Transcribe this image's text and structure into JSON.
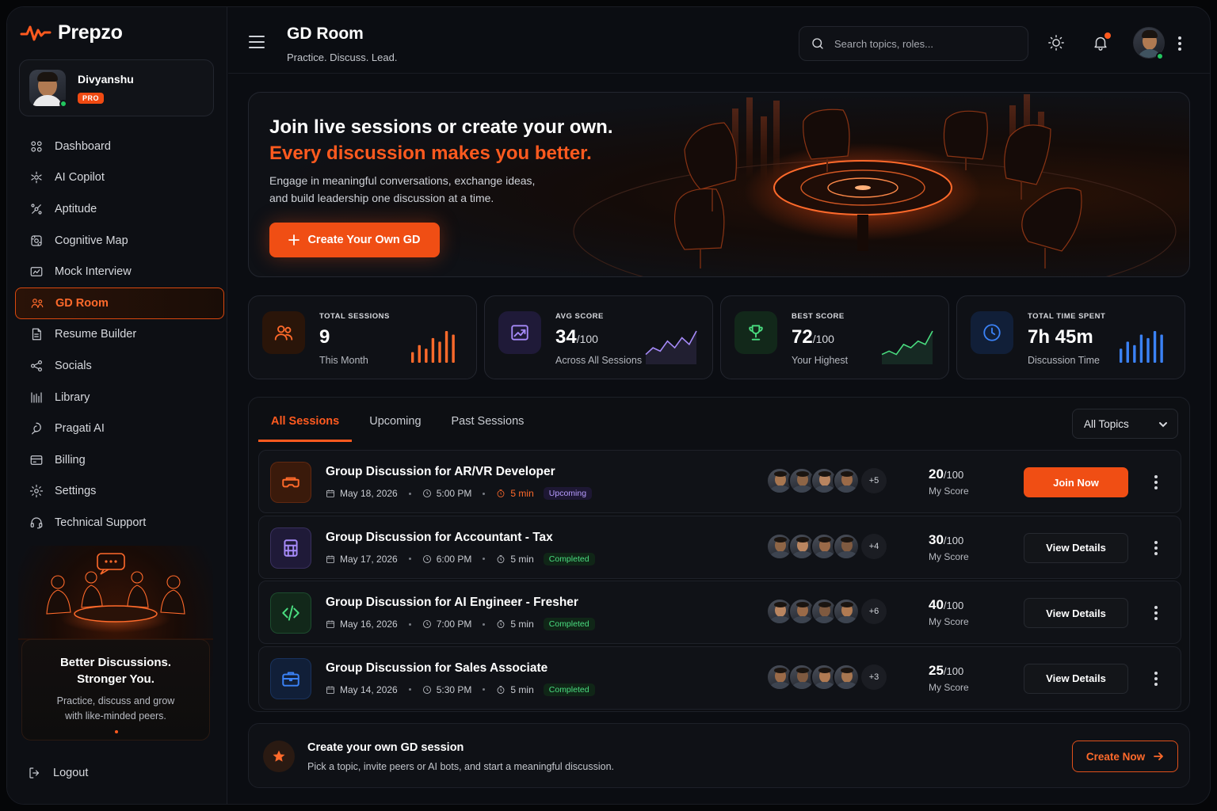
{
  "brand": {
    "name": "Prepzo",
    "accent": "#f04e14"
  },
  "user": {
    "name": "Divyanshu",
    "badge": "PRO"
  },
  "sidebar": {
    "items": [
      {
        "label": "Dashboard",
        "icon": "dashboard-icon"
      },
      {
        "label": "AI Copilot",
        "icon": "copilot-icon"
      },
      {
        "label": "Aptitude",
        "icon": "aptitude-icon"
      },
      {
        "label": "Cognitive Map",
        "icon": "cognitive-map-icon"
      },
      {
        "label": "Mock Interview",
        "icon": "mock-interview-icon"
      },
      {
        "label": "GD Room",
        "icon": "gd-room-icon",
        "active": true
      },
      {
        "label": "Resume Builder",
        "icon": "resume-icon"
      },
      {
        "label": "Socials",
        "icon": "share-icon"
      },
      {
        "label": "Library",
        "icon": "library-icon"
      },
      {
        "label": "Pragati AI",
        "icon": "pragati-icon"
      },
      {
        "label": "Billing",
        "icon": "billing-icon"
      },
      {
        "label": "Settings",
        "icon": "gear-icon"
      },
      {
        "label": "Technical Support",
        "icon": "headset-icon"
      }
    ],
    "promo": {
      "title_line1": "Better Discussions.",
      "title_line2": "Stronger You.",
      "sub_line1": "Practice, discuss and grow",
      "sub_line2": "with like-minded peers."
    },
    "logout": "Logout"
  },
  "header": {
    "title": "GD Room",
    "subtitle": "Practice. Discuss. Lead.",
    "search_placeholder": "Search topics, roles..."
  },
  "hero": {
    "line1": "Join live sessions or create your own.",
    "line2": "Every discussion makes you better.",
    "desc_line1": "Engage in meaningful conversations, exchange ideas,",
    "desc_line2": "and build leadership one discussion at a time.",
    "button": "Create Your Own GD"
  },
  "stats": [
    {
      "label": "TOTAL SESSIONS",
      "value": "9",
      "unit": "",
      "sub": "This Month",
      "color": "#ff6a2b",
      "bg": "#2a1509",
      "icon": "users-icon",
      "chart": "bars",
      "series": [
        3,
        5,
        4,
        7,
        6,
        9,
        8
      ]
    },
    {
      "label": "AVG SCORE",
      "value": "34",
      "unit": "/100",
      "sub": "Across All Sessions",
      "color": "#a78bfa",
      "bg": "#1f1a38",
      "icon": "trend-up-icon",
      "chart": "line",
      "series": [
        2,
        4,
        3,
        6,
        4,
        7,
        5,
        9
      ]
    },
    {
      "label": "BEST SCORE",
      "value": "72",
      "unit": "/100",
      "sub": "Your Highest",
      "color": "#4ade80",
      "bg": "#12281a",
      "icon": "trophy-icon",
      "chart": "line",
      "series": [
        2,
        3,
        2,
        5,
        4,
        6,
        5,
        9
      ]
    },
    {
      "label": "TOTAL TIME SPENT",
      "value": "7h 45m",
      "unit": "",
      "sub": "Discussion Time",
      "color": "#3b82f6",
      "bg": "#111f38",
      "icon": "clock-icon",
      "chart": "bars",
      "series": [
        4,
        6,
        5,
        8,
        7,
        9,
        8
      ]
    }
  ],
  "tabs": [
    "All Sessions",
    "Upcoming",
    "Past Sessions"
  ],
  "topic_filter": "All Topics",
  "sessions": [
    {
      "title": "Group Discussion for AR/VR Developer",
      "date": "May 18, 2026",
      "time": "5:00 PM",
      "duration": "5 min",
      "status": "Upcoming",
      "more": "+5",
      "score": "20",
      "score_unit": "/100",
      "score_label": "My Score",
      "action": "Join Now",
      "primary": true,
      "icon": "vr-headset-icon",
      "color": "#ff6a2b",
      "bg": "#3a1a0b"
    },
    {
      "title": "Group Discussion for Accountant - Tax",
      "date": "May 17, 2026",
      "time": "6:00 PM",
      "duration": "5 min",
      "status": "Completed",
      "more": "+4",
      "score": "30",
      "score_unit": "/100",
      "score_label": "My Score",
      "action": "View Details",
      "primary": false,
      "icon": "calculator-icon",
      "color": "#a78bfa",
      "bg": "#1f1a38"
    },
    {
      "title": "Group Discussion for AI Engineer - Fresher",
      "date": "May 16, 2026",
      "time": "7:00 PM",
      "duration": "5 min",
      "status": "Completed",
      "more": "+6",
      "score": "40",
      "score_unit": "/100",
      "score_label": "My Score",
      "action": "View Details",
      "primary": false,
      "icon": "code-icon",
      "color": "#4ade80",
      "bg": "#12281a"
    },
    {
      "title": "Group Discussion for Sales Associate",
      "date": "May 14, 2026",
      "time": "5:30 PM",
      "duration": "5 min",
      "status": "Completed",
      "more": "+3",
      "score": "25",
      "score_unit": "/100",
      "score_label": "My Score",
      "action": "View Details",
      "primary": false,
      "icon": "briefcase-icon",
      "color": "#3b82f6",
      "bg": "#111f38"
    }
  ],
  "cta": {
    "title": "Create your own GD session",
    "sub": "Pick a topic, invite peers or AI bots, and start a meaningful discussion.",
    "button": "Create Now"
  }
}
